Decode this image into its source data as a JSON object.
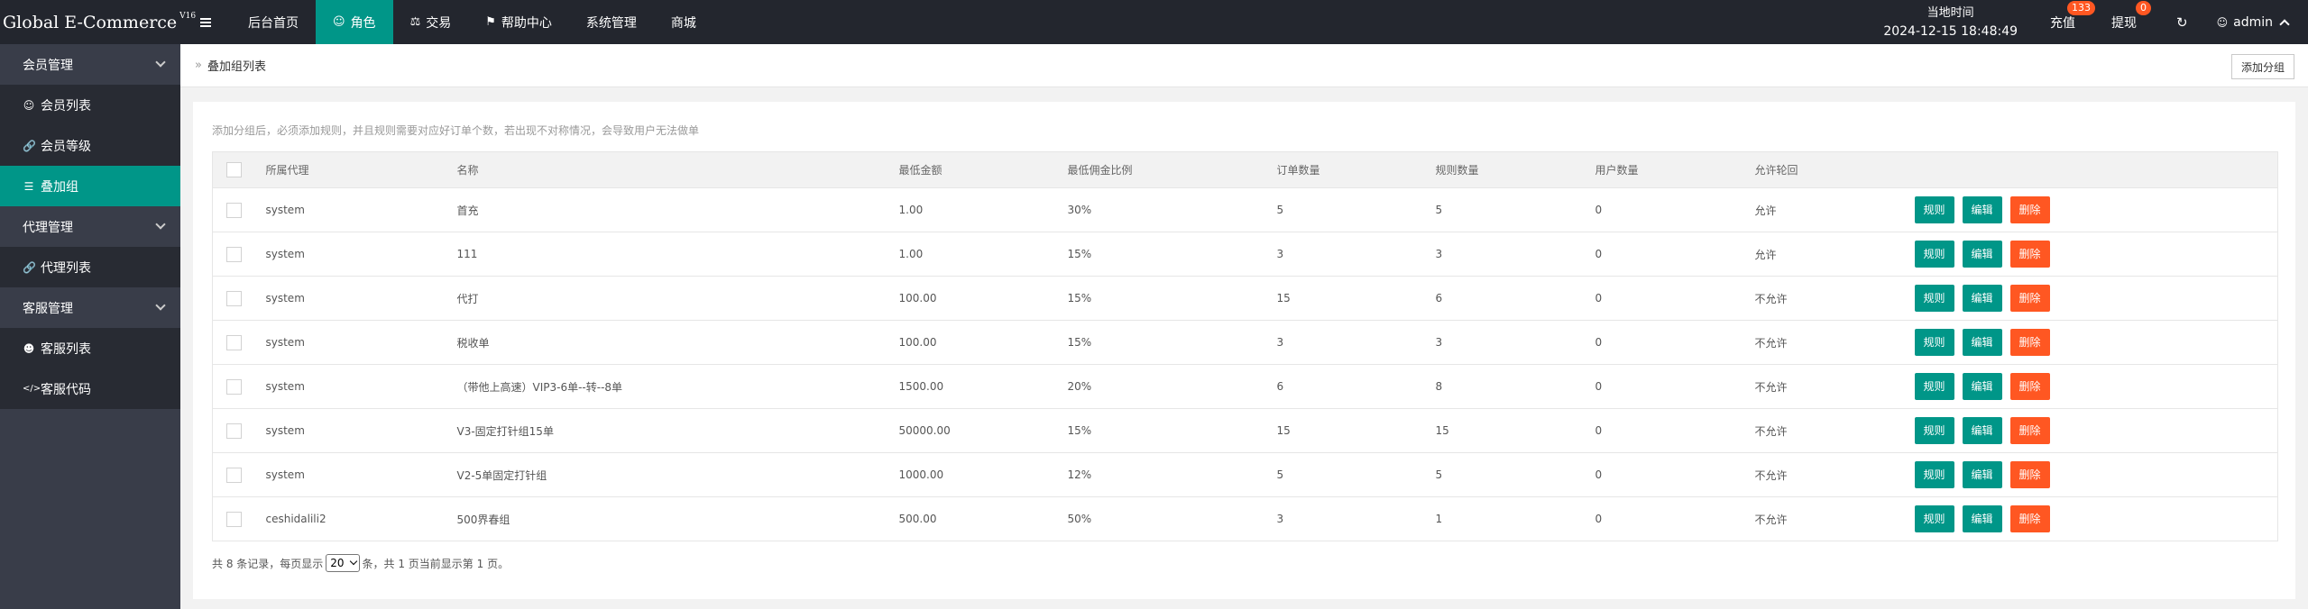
{
  "header": {
    "logo": "Global E-Commerce",
    "logo_sup": "V16",
    "nav": [
      {
        "label": "后台首页",
        "icon": "",
        "active": false
      },
      {
        "label": "角色",
        "icon": "user-icon",
        "active": true
      },
      {
        "label": "交易",
        "icon": "scale-icon",
        "active": false
      },
      {
        "label": "帮助中心",
        "icon": "flag-icon",
        "active": false
      },
      {
        "label": "系统管理",
        "icon": "",
        "active": false
      },
      {
        "label": "商城",
        "icon": "",
        "active": false
      }
    ],
    "time_label": "当地时间",
    "time_value": "2024-12-15 18:48:49",
    "recharge_label": "充值",
    "recharge_badge": "133",
    "withdraw_label": "提现",
    "withdraw_badge": "0",
    "user_label": "admin"
  },
  "sidebar": {
    "groups": [
      {
        "label": "会员管理",
        "items": [
          {
            "label": "会员列表",
            "icon": "user-icon"
          },
          {
            "label": "会员等级",
            "icon": "link-icon"
          },
          {
            "label": "叠加组",
            "icon": "list-icon",
            "active": true
          }
        ]
      },
      {
        "label": "代理管理",
        "items": [
          {
            "label": "代理列表",
            "icon": "link-icon"
          }
        ]
      },
      {
        "label": "客服管理",
        "items": [
          {
            "label": "客服列表",
            "icon": "users-icon"
          },
          {
            "label": "客服代码",
            "icon": "code-icon"
          }
        ]
      }
    ]
  },
  "breadcrumb": {
    "title": "叠加组列表",
    "add_button": "添加分组"
  },
  "main": {
    "tip": "添加分组后，必须添加规则，并且规则需要对应好订单个数，若出现不对称情况，会导致用户无法做单",
    "columns": [
      "所属代理",
      "名称",
      "最低金额",
      "最低佣金比例",
      "订单数量",
      "规则数量",
      "用户数量",
      "允许轮回"
    ],
    "actions": {
      "rules": "规则",
      "edit": "编辑",
      "delete": "删除"
    },
    "rows": [
      [
        "system",
        "首充",
        "1.00",
        "30%",
        "5",
        "5",
        "0",
        "允许"
      ],
      [
        "system",
        "111",
        "1.00",
        "15%",
        "3",
        "3",
        "0",
        "允许"
      ],
      [
        "system",
        "代打",
        "100.00",
        "15%",
        "15",
        "6",
        "0",
        "不允许"
      ],
      [
        "system",
        "税收单",
        "100.00",
        "15%",
        "3",
        "3",
        "0",
        "不允许"
      ],
      [
        "system",
        "（带他上高速）VIP3-6单--转--8单",
        "1500.00",
        "20%",
        "6",
        "8",
        "0",
        "不允许"
      ],
      [
        "system",
        "V3-固定打针组15单",
        "50000.00",
        "15%",
        "15",
        "15",
        "0",
        "不允许"
      ],
      [
        "system",
        "V2-5单固定打针组",
        "1000.00",
        "12%",
        "5",
        "5",
        "0",
        "不允许"
      ],
      [
        "ceshidalili2",
        "500界春组",
        "500.00",
        "50%",
        "3",
        "1",
        "0",
        "不允许"
      ]
    ],
    "pager": {
      "prefix": "共 8 条记录，每页显示",
      "page_size": "20",
      "suffix": "条，共 1 页当前显示第 1 页。"
    }
  }
}
